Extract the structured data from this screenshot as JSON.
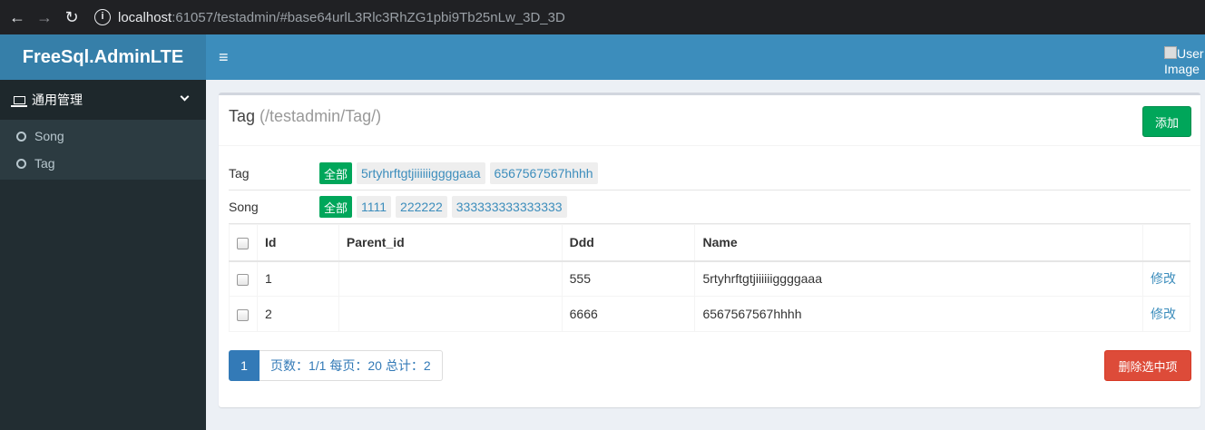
{
  "browser": {
    "back_icon": "arrow-left-icon",
    "forward_icon": "arrow-right-icon",
    "reload_icon": "reload-icon",
    "url_host": "localhost",
    "url_rest": ":61057/testadmin/#base64urlL3Rlc3RhZG1pbi9Tb25nLw_3D_3D"
  },
  "header": {
    "brand": "FreeSql.AdminLTE",
    "user_image_alt": "User Image"
  },
  "sidebar": {
    "group_label": "通用管理",
    "items": [
      {
        "label": "Song"
      },
      {
        "label": "Tag"
      }
    ]
  },
  "box": {
    "title": "Tag",
    "path": "(/testadmin/Tag/)",
    "add_label": "添加"
  },
  "filters": [
    {
      "label": "Tag",
      "chips": [
        "全部",
        "5rtyhrftgtjiiiiiiggggaaa",
        "6567567567hhhh"
      ],
      "active": 0
    },
    {
      "label": "Song",
      "chips": [
        "全部",
        "1111",
        "222222",
        "333333333333333"
      ],
      "active": 0
    }
  ],
  "table": {
    "columns": [
      "Id",
      "Parent_id",
      "Ddd",
      "Name",
      ""
    ],
    "rows": [
      {
        "id": "1",
        "parent_id": "",
        "ddd": "555",
        "name": "5rtyhrftgtjiiiiiiggggaaa",
        "action": "修改"
      },
      {
        "id": "2",
        "parent_id": "",
        "ddd": "6666",
        "name": "6567567567hhhh",
        "action": "修改"
      }
    ]
  },
  "pagination": {
    "current": "1",
    "info": "页数：1/1 每页：20 总计：2"
  },
  "delete_label": "删除选中项",
  "colors": {
    "accent": "#3c8dbc",
    "success": "#00a65a",
    "danger": "#dd4b39",
    "sidebar": "#222d32"
  }
}
